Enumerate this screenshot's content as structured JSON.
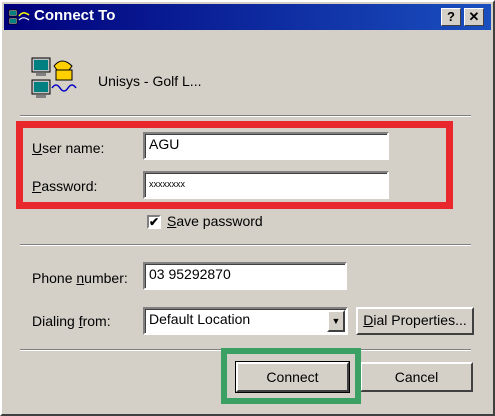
{
  "window": {
    "title": "Connect To",
    "help_glyph": "?",
    "close_glyph": "✕"
  },
  "connection": {
    "name": "Unisys - Golf L..."
  },
  "form": {
    "username_label_accel": "U",
    "username_label_rest": "ser name:",
    "username_value": "AGU",
    "password_label_accel": "P",
    "password_label_rest": "assword:",
    "password_value": "xxxxxxxx",
    "save_password_checked": "✔",
    "save_password_accel": "S",
    "save_password_rest": "ave password",
    "phone_label_prefix": "Phone ",
    "phone_label_accel": "n",
    "phone_label_rest": "umber:",
    "phone_value": "03 95292870",
    "dialing_label_prefix": "Dialing ",
    "dialing_label_accel": "f",
    "dialing_label_rest": "rom:",
    "dialing_value": "Default Location",
    "dial_props_accel": "D",
    "dial_props_rest": "ial Properties..."
  },
  "buttons": {
    "connect": "Connect",
    "cancel": "Cancel"
  },
  "icons": {
    "app": "dialup-networking-icon",
    "connection": "computer-phone-icon",
    "dropdown": "chevron-down-icon"
  },
  "colors": {
    "titlebar_start": "#00007b",
    "titlebar_end": "#1a4fbf",
    "highlight_red": "#e8282d",
    "highlight_green": "#3aa063"
  }
}
